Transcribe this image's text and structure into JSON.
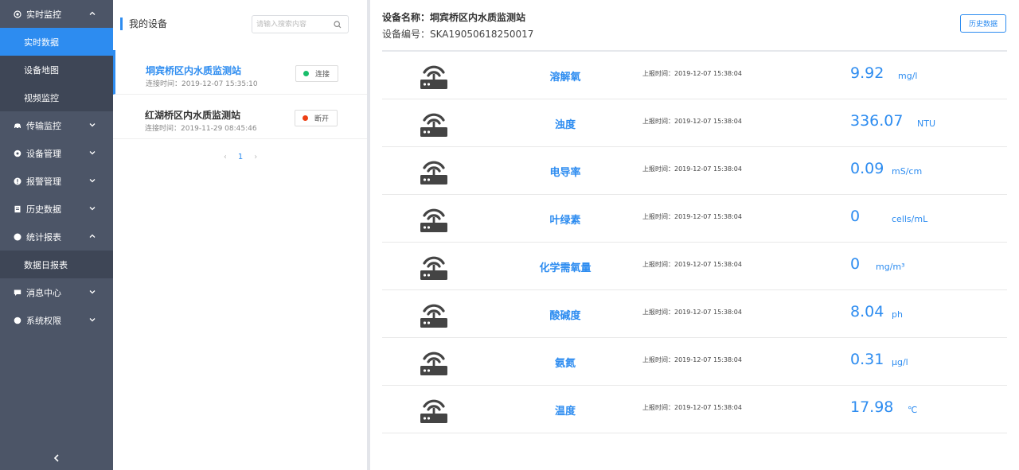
{
  "sidebar": {
    "sections": [
      {
        "label": "实时监控",
        "icon": "target-icon",
        "expanded": true,
        "children": [
          {
            "label": "实时数据",
            "active": true
          },
          {
            "label": "设备地图",
            "active": false
          },
          {
            "label": "视频监控",
            "active": false
          }
        ]
      },
      {
        "label": "传输监控",
        "icon": "car-icon",
        "expanded": false,
        "children": []
      },
      {
        "label": "设备管理",
        "icon": "gear-icon",
        "expanded": false,
        "children": []
      },
      {
        "label": "报警管理",
        "icon": "alert-icon",
        "expanded": false,
        "children": []
      },
      {
        "label": "历史数据",
        "icon": "document-icon",
        "expanded": false,
        "children": []
      },
      {
        "label": "统计报表",
        "icon": "chart-icon",
        "expanded": true,
        "children": [
          {
            "label": "数据日报表",
            "active": false
          }
        ]
      },
      {
        "label": "消息中心",
        "icon": "message-icon",
        "expanded": false,
        "children": []
      },
      {
        "label": "系统权限",
        "icon": "lock-icon",
        "expanded": false,
        "children": []
      }
    ],
    "collapse_icon": "chevron-left-icon"
  },
  "device_panel": {
    "title": "我的设备",
    "search": {
      "placeholder": "请输入搜索内容",
      "value": ""
    },
    "devices": [
      {
        "name": "垌宾桥区内水质监测站",
        "time": "连接时间：2019-12-07 15:35:10",
        "status": "连接",
        "status_color": "#19be6b",
        "selected": true
      },
      {
        "name": "红湖桥区内水质监测站",
        "time": "连接时间：2019-11-29 08:45:46",
        "status": "断开",
        "status_color": "#ed3f14",
        "selected": false
      }
    ],
    "pager": {
      "prev": "‹",
      "current": "1",
      "next": "›"
    }
  },
  "main": {
    "device_name": "设备名称：垌宾桥区内水质监测站",
    "device_code": "设备编号：SKA19050618250017",
    "history_button": "历史数据",
    "readings": [
      {
        "label": "溶解氧",
        "time": "上报时间：2019-12-07 15:38:04",
        "value": "9.92",
        "unit": "mg/l"
      },
      {
        "label": "浊度",
        "time": "上报时间：2019-12-07 15:38:04",
        "value": "336.07",
        "unit": "NTU"
      },
      {
        "label": "电导率",
        "time": "上报时间：2019-12-07 15:38:04",
        "value": "0.09",
        "unit": "mS/cm"
      },
      {
        "label": "叶绿素",
        "time": "上报时间：2019-12-07 15:38:04",
        "value": "0",
        "unit": "cells/mL"
      },
      {
        "label": "化学需氧量",
        "time": "上报时间：2019-12-07 15:38:04",
        "value": "0",
        "unit": "mg/m³"
      },
      {
        "label": "酸碱度",
        "time": "上报时间：2019-12-07 15:38:04",
        "value": "8.04",
        "unit": "ph"
      },
      {
        "label": "氨氮",
        "time": "上报时间：2019-12-07 15:38:04",
        "value": "0.31",
        "unit": "μg/l"
      },
      {
        "label": "温度",
        "time": "上报时间：2019-12-07 15:38:04",
        "value": "17.98",
        "unit": "℃"
      }
    ]
  },
  "colors": {
    "accent": "#2d8cf0",
    "sidebar": "#4c5567",
    "sidebar_sub": "#3e4656",
    "connected": "#19be6b",
    "disconnected": "#ed3f14"
  }
}
